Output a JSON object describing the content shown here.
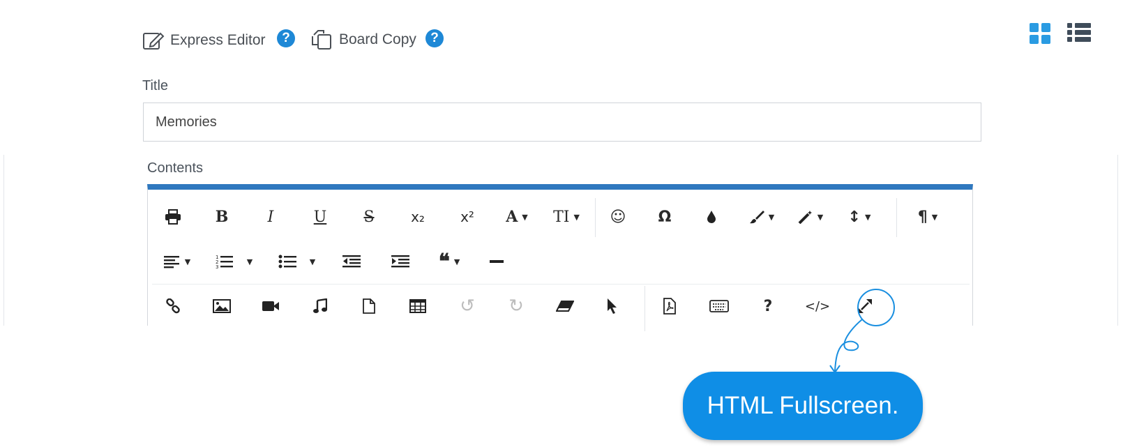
{
  "header": {
    "express_editor": "Express Editor",
    "board_copy": "Board Copy",
    "help_glyph": "?"
  },
  "view_toggle": {
    "grid": "grid-view-icon",
    "list": "list-view-icon"
  },
  "form": {
    "title_label": "Title",
    "title_value": "Memories",
    "contents_label": "Contents"
  },
  "toolbar": {
    "row1": [
      {
        "name": "print",
        "glyph": "🖶"
      },
      {
        "name": "bold",
        "glyph": "B"
      },
      {
        "name": "italic",
        "glyph": "I"
      },
      {
        "name": "underline",
        "glyph": "U"
      },
      {
        "name": "strikethrough",
        "glyph": "S"
      },
      {
        "name": "subscript",
        "glyph": "x₂"
      },
      {
        "name": "superscript",
        "glyph": "x²"
      },
      {
        "name": "font-family",
        "glyph": "A"
      },
      {
        "name": "font-size",
        "glyph": "TI"
      },
      {
        "name": "emoticons",
        "glyph": "☺"
      },
      {
        "name": "special-characters",
        "glyph": "Ω"
      },
      {
        "name": "text-color",
        "glyph": "💧"
      },
      {
        "name": "brush",
        "glyph": "🖌"
      },
      {
        "name": "magic",
        "glyph": "🪄"
      },
      {
        "name": "line-height",
        "glyph": "↕"
      },
      {
        "name": "paragraph",
        "glyph": "¶"
      }
    ],
    "row2": [
      {
        "name": "align",
        "glyph": "≡"
      },
      {
        "name": "ordered-list",
        "glyph": "☰"
      },
      {
        "name": "unordered-list",
        "glyph": "☰"
      },
      {
        "name": "outdent",
        "glyph": "⇤"
      },
      {
        "name": "indent",
        "glyph": "⇥"
      },
      {
        "name": "quote",
        "glyph": "❝"
      },
      {
        "name": "horizontal-rule",
        "glyph": "—"
      }
    ],
    "row3": [
      {
        "name": "link",
        "glyph": "🔗"
      },
      {
        "name": "image",
        "glyph": "🖼"
      },
      {
        "name": "video",
        "glyph": "🎥"
      },
      {
        "name": "audio",
        "glyph": "♫"
      },
      {
        "name": "file",
        "glyph": "🗋"
      },
      {
        "name": "table",
        "glyph": "▦"
      },
      {
        "name": "undo",
        "glyph": "↺"
      },
      {
        "name": "redo",
        "glyph": "↻"
      },
      {
        "name": "eraser",
        "glyph": "⌫"
      },
      {
        "name": "select",
        "glyph": "➤"
      },
      {
        "name": "pdf",
        "glyph": "📄"
      },
      {
        "name": "keyboard",
        "glyph": "⌨"
      },
      {
        "name": "help",
        "glyph": "?"
      },
      {
        "name": "html",
        "glyph": "</>"
      },
      {
        "name": "fullscreen",
        "glyph": "⤢"
      }
    ]
  },
  "callout": {
    "text": "HTML Fullscreen.",
    "color": "#0f8ee6"
  },
  "colors": {
    "accent": "#2f78bf",
    "help": "#1e88d6",
    "grid_view": "#2a9be2"
  }
}
